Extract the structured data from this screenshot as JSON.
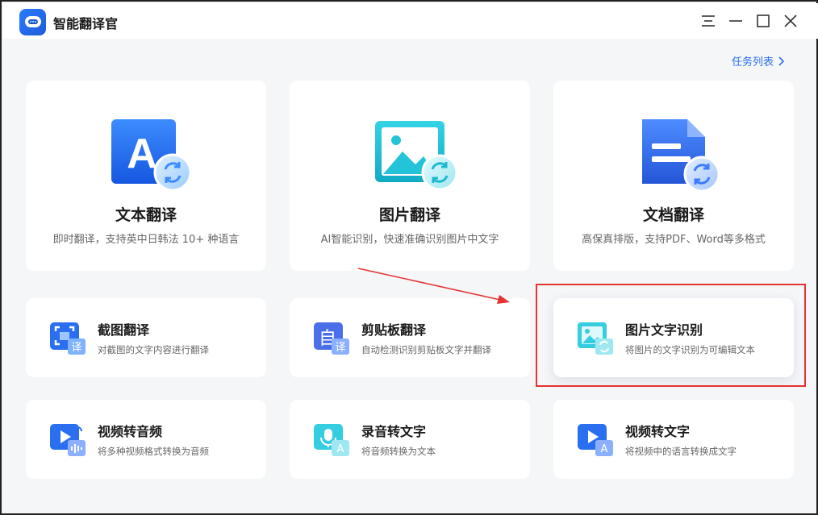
{
  "app": {
    "title": "智能翻译官"
  },
  "header": {
    "task_list_label": "任务列表"
  },
  "big_cards": [
    {
      "title": "文本翻译",
      "desc": "即时翻译，支持英中日韩法 10+ 种语言",
      "icon": "text-translate-icon"
    },
    {
      "title": "图片翻译",
      "desc": "AI智能识别，快速准确识别图片中文字",
      "icon": "image-translate-icon"
    },
    {
      "title": "文档翻译",
      "desc": "高保真排版，支持PDF、Word等多格式",
      "icon": "document-translate-icon"
    }
  ],
  "small_cards": [
    {
      "title": "截图翻译",
      "desc": "对截图的文字内容进行翻译",
      "icon": "screenshot-translate-icon"
    },
    {
      "title": "剪贴板翻译",
      "desc": "自动检测识别剪贴板文字并翻译",
      "icon": "clipboard-translate-icon"
    },
    {
      "title": "图片文字识别",
      "desc": "将图片的文字识别为可编辑文本",
      "icon": "image-ocr-icon"
    },
    {
      "title": "视频转音频",
      "desc": "将多种视频格式转换为音频",
      "icon": "video-to-audio-icon"
    },
    {
      "title": "录音转文字",
      "desc": "将音频转换为文本",
      "icon": "audio-to-text-icon"
    },
    {
      "title": "视频转文字",
      "desc": "将视频中的语言转换成文字",
      "icon": "video-to-text-icon"
    }
  ],
  "big_card_icon_letters": [
    "A"
  ],
  "colors": {
    "accent": "#2a6ff0",
    "annotation": "#e53232",
    "teal": "#23c4d8"
  }
}
